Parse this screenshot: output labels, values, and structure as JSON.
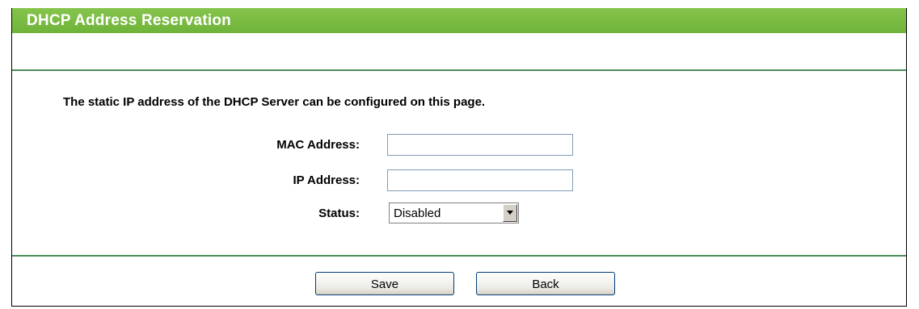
{
  "header": {
    "title": "DHCP Address Reservation"
  },
  "description": "The static IP address of the DHCP Server can be configured on this page.",
  "form": {
    "mac_label": "MAC Address:",
    "mac_value": "",
    "ip_label": "IP Address:",
    "ip_value": "",
    "status_label": "Status:",
    "status_value": "Disabled"
  },
  "buttons": {
    "save_label": "Save",
    "back_label": "Back"
  },
  "colors": {
    "title_bar": "#7dbb45",
    "divider": "#4d8a58"
  }
}
